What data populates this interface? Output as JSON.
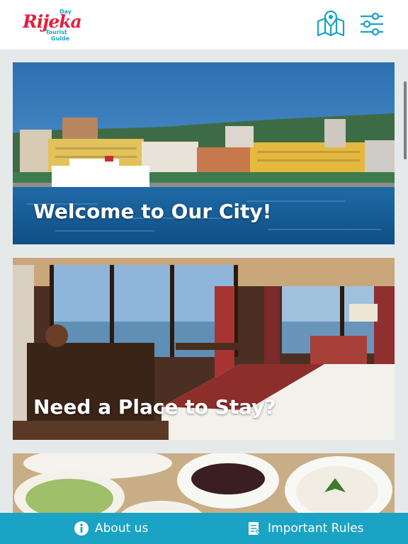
{
  "header": {
    "logo": {
      "name": "Rijeka",
      "day": "Day",
      "line1": "Tourist",
      "line2": "Guide"
    },
    "icons": [
      "map-icon",
      "filter-icon"
    ]
  },
  "cards": [
    {
      "title": "Welcome to Our City!",
      "image": "rijeka-harbor-photo"
    },
    {
      "title": "Need a Place to Stay?",
      "image": "hotel-room-photo"
    },
    {
      "title": "",
      "image": "food-dishes-photo"
    }
  ],
  "bottom_bar": {
    "about_label": "About us",
    "rules_label": "Important Rules",
    "icons": [
      "info-icon",
      "document-icon"
    ]
  },
  "colors": {
    "accent": "#1ba3c5",
    "brand_red": "#e0213f",
    "background": "#e6e9ea"
  }
}
